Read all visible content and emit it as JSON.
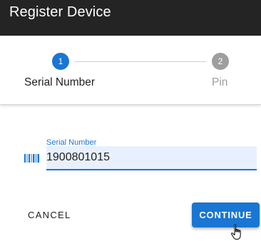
{
  "dialog": {
    "title": "Register Device"
  },
  "stepper": {
    "steps": [
      {
        "number": "1",
        "label": "Serial Number",
        "state": "active"
      },
      {
        "number": "2",
        "label": "Pin",
        "state": "inactive"
      }
    ]
  },
  "serial_field": {
    "label": "Serial Number",
    "value": "1900801015",
    "icon": "barcode-icon"
  },
  "actions": {
    "cancel_label": "CANCEL",
    "continue_label": "CONTINUE"
  },
  "colors": {
    "titlebar_bg": "#242424",
    "accent": "#1976d2",
    "inactive_step": "#9e9e9e",
    "field_bg": "#e8f0fe"
  }
}
